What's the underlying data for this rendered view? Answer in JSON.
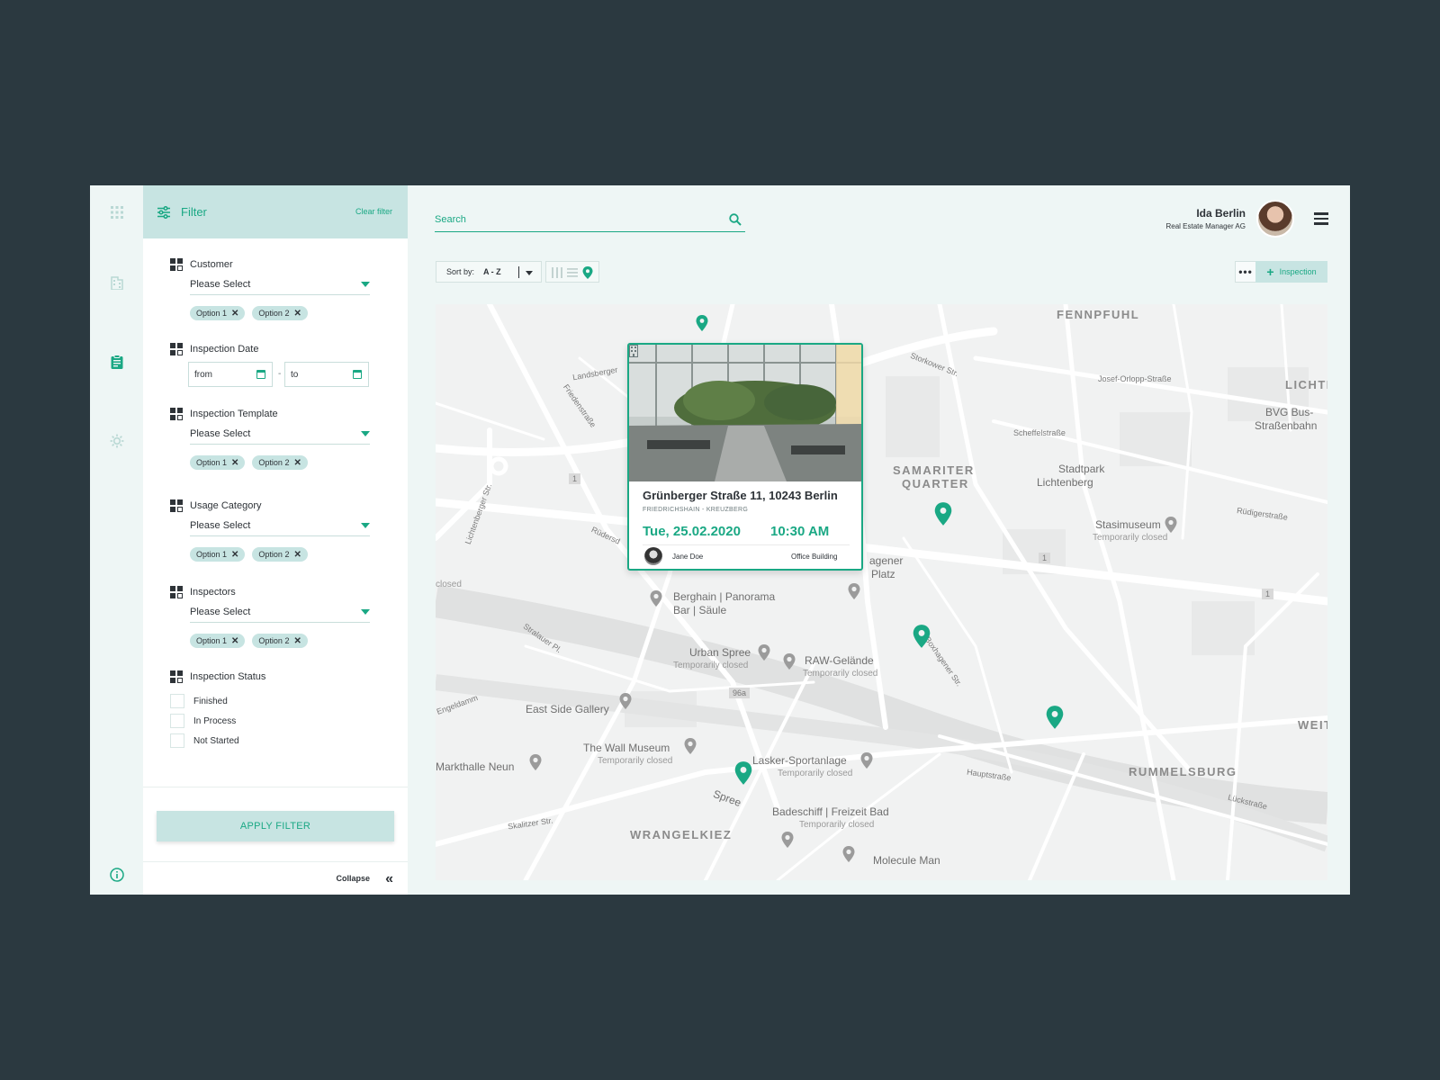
{
  "colors": {
    "accent": "#1aa884",
    "accent_light": "#c7e4e2",
    "background": "#2b3940",
    "app_bg": "#eef6f5"
  },
  "rail": {
    "icons": [
      "apps-icon",
      "building-icon",
      "clipboard-icon",
      "settings-gear-icon",
      "info-icon"
    ]
  },
  "filter": {
    "title": "Filter",
    "clear_label": "Clear filter",
    "customer": {
      "label": "Customer",
      "placeholder": "Please Select",
      "chips": [
        "Option 1",
        "Option 2"
      ]
    },
    "inspection_date": {
      "label": "Inspection Date",
      "from": "from",
      "to": "to",
      "separator": "-"
    },
    "template": {
      "label": "Inspection Template",
      "placeholder": "Please Select",
      "chips": [
        "Option 1",
        "Option 2"
      ]
    },
    "usage": {
      "label": "Usage Category",
      "placeholder": "Please Select",
      "chips": [
        "Option 1",
        "Option 2"
      ]
    },
    "inspectors": {
      "label": "Inspectors",
      "placeholder": "Please Select",
      "chips": [
        "Option 1",
        "Option 2"
      ]
    },
    "status": {
      "label": "Inspection Status",
      "options": [
        "Finished",
        "In Process",
        "Not Started"
      ]
    },
    "apply_label": "APPLY FILTER",
    "collapse_label": "Collapse",
    "collapse_icon": "«"
  },
  "header": {
    "search_placeholder": "Search",
    "user_name": "Ida Berlin",
    "user_role": "Real Estate Manager AG"
  },
  "toolbar": {
    "sort_label": "Sort by:",
    "sort_value": "A - Z",
    "more_label": "•••",
    "add_label": "Inspection",
    "add_icon": "+"
  },
  "map": {
    "labels": {
      "fennpfuhl": "FENNPFUHL",
      "lichte": "LICHTE",
      "samariter": "SAMARITER",
      "quarter": "QUARTER",
      "stadtpark1": "Stadtpark",
      "stadtpark2": "Lichtenberg",
      "bvg1": "BVG Bus-",
      "bvg2": "Straßenbahn",
      "stasi": "Stasimuseum",
      "stasi_sub": "Temporarily closed",
      "berghain1": "Berghain | Panorama",
      "berghain2": "Bar | Säule",
      "agener": "agener",
      "platz": "Platz",
      "urban": "Urban Spree",
      "urban_sub": "Temporarily closed",
      "raw": "RAW-Gelände",
      "raw_sub": "Temporarily closed",
      "eastside": "East Side Gallery",
      "wallmuseum": "The Wall Museum",
      "wallmuseum_sub": "Temporarily closed",
      "lasker": "Lasker-Sportanlage",
      "lasker_sub": "Temporarily closed",
      "markthalle": "Markthalle Neun",
      "badeschiff": "Badeschiff | Freizeit Bad",
      "badeschiff_sub": "Temporarily closed",
      "molecule": "Molecule Man",
      "wrangelkiez": "WRANGELKIEZ",
      "rummelsburg": "RUMMELSBURG",
      "weit": "WEIT",
      "closed": "closed",
      "spree": "Spree",
      "landsberger": "Landsberger",
      "storkower": "Storkower Str.",
      "josef": "Josef-Orlopp-Straße",
      "scheffel": "Scheffelstraße",
      "ruedigerstr": "Rüdigerstraße",
      "hauptstr": "Hauptstraße",
      "lueckstr": "Lückstraße",
      "skalitzer": "Skalitzer Str.",
      "engeldamm": "Engeldamm",
      "lichtenberger": "Lichtenberger Str.",
      "friedenstr": "Friedenstraße",
      "strom": "Stralauer Pl.",
      "boxhagener": "Boxhagener Str.",
      "ruedersdorfer": "Rüdersd",
      "road96a": "96a",
      "road1a": "1",
      "road1b": "1",
      "road1c": "1"
    }
  },
  "card": {
    "address": "Grünberger Straße 11, 10243 Berlin",
    "district": "FRIEDRICHSHAIN - KREUZBERG",
    "date": "Tue, 25.02.2020",
    "time": "10:30 AM",
    "inspector": "Jane Doe",
    "building_type": "Office Building"
  }
}
